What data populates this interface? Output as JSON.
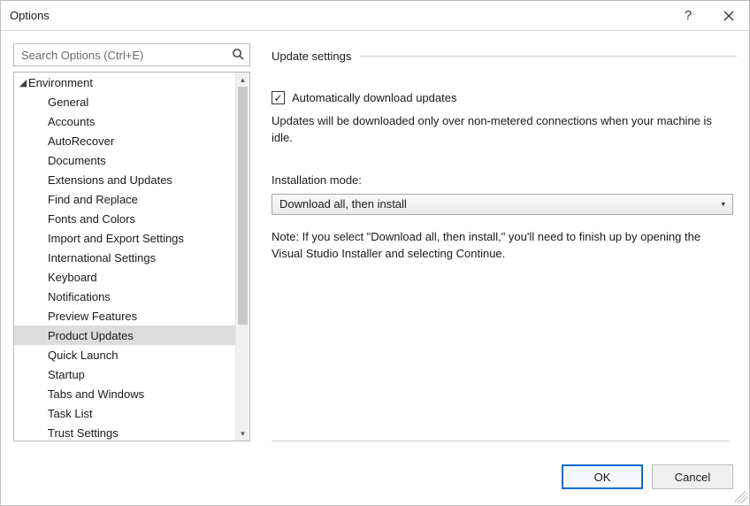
{
  "dialog": {
    "title": "Options"
  },
  "search": {
    "placeholder": "Search Options (Ctrl+E)"
  },
  "tree": {
    "root": "Environment",
    "items": [
      {
        "label": "General"
      },
      {
        "label": "Accounts"
      },
      {
        "label": "AutoRecover"
      },
      {
        "label": "Documents"
      },
      {
        "label": "Extensions and Updates"
      },
      {
        "label": "Find and Replace"
      },
      {
        "label": "Fonts and Colors"
      },
      {
        "label": "Import and Export Settings"
      },
      {
        "label": "International Settings"
      },
      {
        "label": "Keyboard"
      },
      {
        "label": "Notifications"
      },
      {
        "label": "Preview Features"
      },
      {
        "label": "Product Updates",
        "selected": true
      },
      {
        "label": "Quick Launch"
      },
      {
        "label": "Startup"
      },
      {
        "label": "Tabs and Windows"
      },
      {
        "label": "Task List"
      },
      {
        "label": "Trust Settings"
      }
    ]
  },
  "panel": {
    "section_title": "Update settings",
    "auto_download_label": "Automatically download updates",
    "auto_download_checked": true,
    "auto_download_desc": "Updates will be downloaded only over non-metered connections when your machine is idle.",
    "install_mode_label": "Installation mode:",
    "install_mode_value": "Download all, then install",
    "install_mode_note": "Note: If you select \"Download all, then install,\" you'll need to finish up by opening the Visual Studio Installer and selecting Continue."
  },
  "buttons": {
    "ok": "OK",
    "cancel": "Cancel"
  }
}
